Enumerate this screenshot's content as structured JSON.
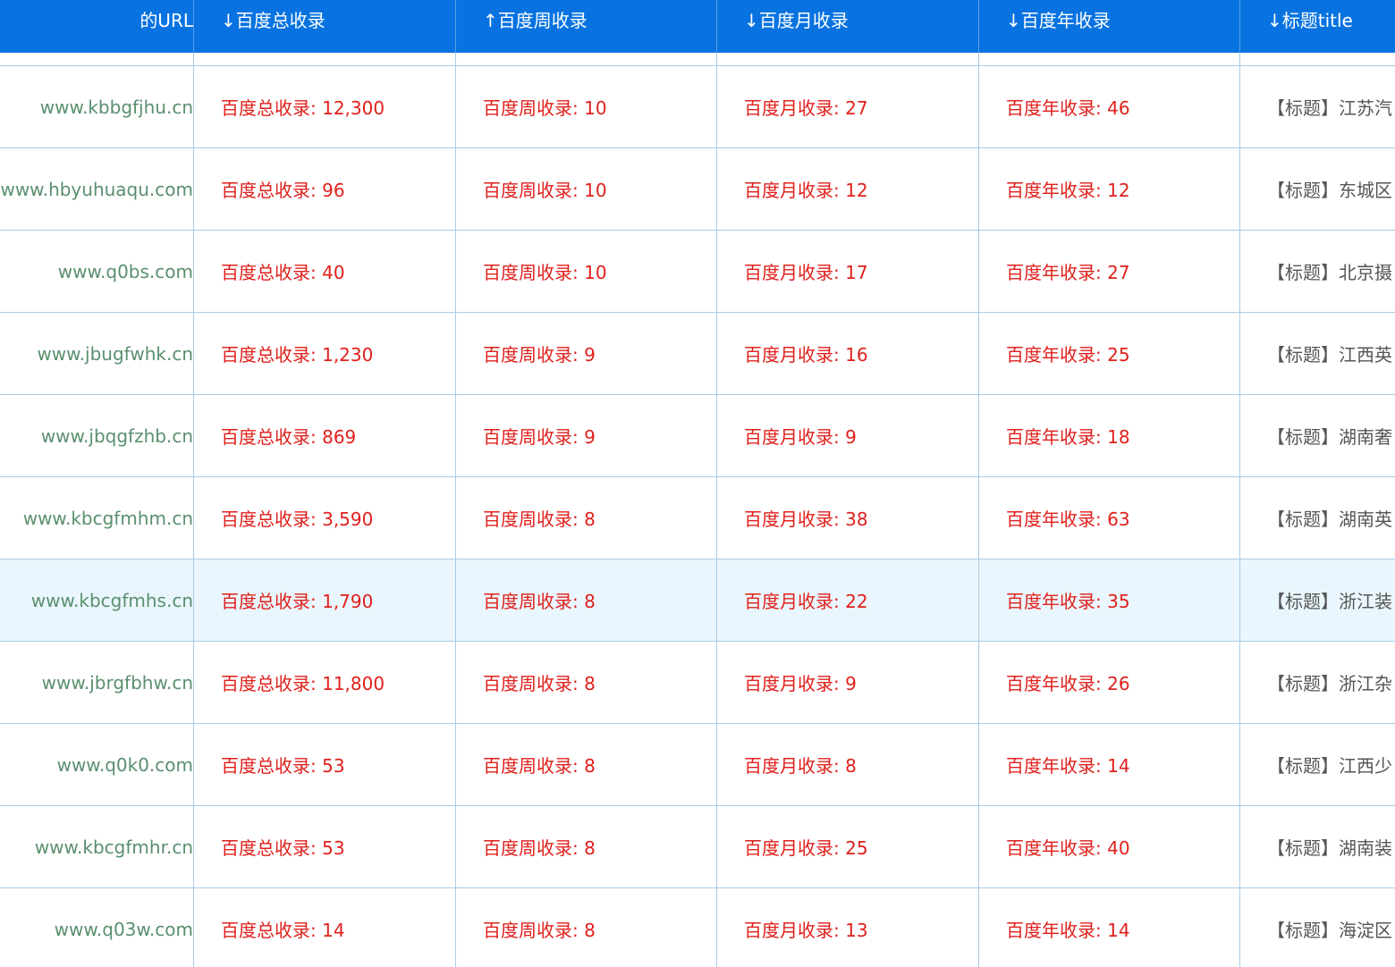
{
  "headers": {
    "url": "的URL",
    "total": "↓百度总收录",
    "week": "↑百度周收录",
    "month": "↓百度月收录",
    "year": "↓百度年收录",
    "title": "↓标题title"
  },
  "rows": [
    {
      "url": "www.kbbgfjhu.cn",
      "total": "百度总收录: 12,300",
      "week": "百度周收录: 10",
      "month": "百度月收录: 27",
      "year": "百度年收录: 46",
      "title": "【标题】江苏汽"
    },
    {
      "url": "www.hbyuhuaqu.com",
      "total": "百度总收录: 96",
      "week": "百度周收录: 10",
      "month": "百度月收录: 12",
      "year": "百度年收录: 12",
      "title": "【标题】东城区"
    },
    {
      "url": "www.q0bs.com",
      "total": "百度总收录: 40",
      "week": "百度周收录: 10",
      "month": "百度月收录: 17",
      "year": "百度年收录: 27",
      "title": "【标题】北京摄"
    },
    {
      "url": "www.jbugfwhk.cn",
      "total": "百度总收录: 1,230",
      "week": "百度周收录: 9",
      "month": "百度月收录: 16",
      "year": "百度年收录: 25",
      "title": "【标题】江西英"
    },
    {
      "url": "www.jbqgfzhb.cn",
      "total": "百度总收录: 869",
      "week": "百度周收录: 9",
      "month": "百度月收录: 9",
      "year": "百度年收录: 18",
      "title": "【标题】湖南奢"
    },
    {
      "url": "www.kbcgfmhm.cn",
      "total": "百度总收录: 3,590",
      "week": "百度周收录: 8",
      "month": "百度月收录: 38",
      "year": "百度年收录: 63",
      "title": "【标题】湖南英"
    },
    {
      "url": "www.kbcgfmhs.cn",
      "total": "百度总收录: 1,790",
      "week": "百度周收录: 8",
      "month": "百度月收录: 22",
      "year": "百度年收录: 35",
      "title": "【标题】浙江装"
    },
    {
      "url": "www.jbrgfbhw.cn",
      "total": "百度总收录: 11,800",
      "week": "百度周收录: 8",
      "month": "百度月收录: 9",
      "year": "百度年收录: 26",
      "title": "【标题】浙江杂"
    },
    {
      "url": "www.q0k0.com",
      "total": "百度总收录: 53",
      "week": "百度周收录: 8",
      "month": "百度月收录: 8",
      "year": "百度年收录: 14",
      "title": "【标题】江西少"
    },
    {
      "url": "www.kbcgfmhr.cn",
      "total": "百度总收录: 53",
      "week": "百度周收录: 8",
      "month": "百度月收录: 25",
      "year": "百度年收录: 40",
      "title": "【标题】湖南装"
    },
    {
      "url": "www.q03w.com",
      "total": "百度总收录: 14",
      "week": "百度周收录: 8",
      "month": "百度月收录: 13",
      "year": "百度年收录: 14",
      "title": "【标题】海淀区"
    }
  ],
  "highlighted_row": 6,
  "colors": {
    "header_bg": "#0873e0",
    "url_text": "#5a8f6e",
    "stat_text": "#e0201c",
    "title_text": "#555555",
    "grid_line": "#a9cbe6",
    "highlight_bg": "#eaf6fd"
  }
}
